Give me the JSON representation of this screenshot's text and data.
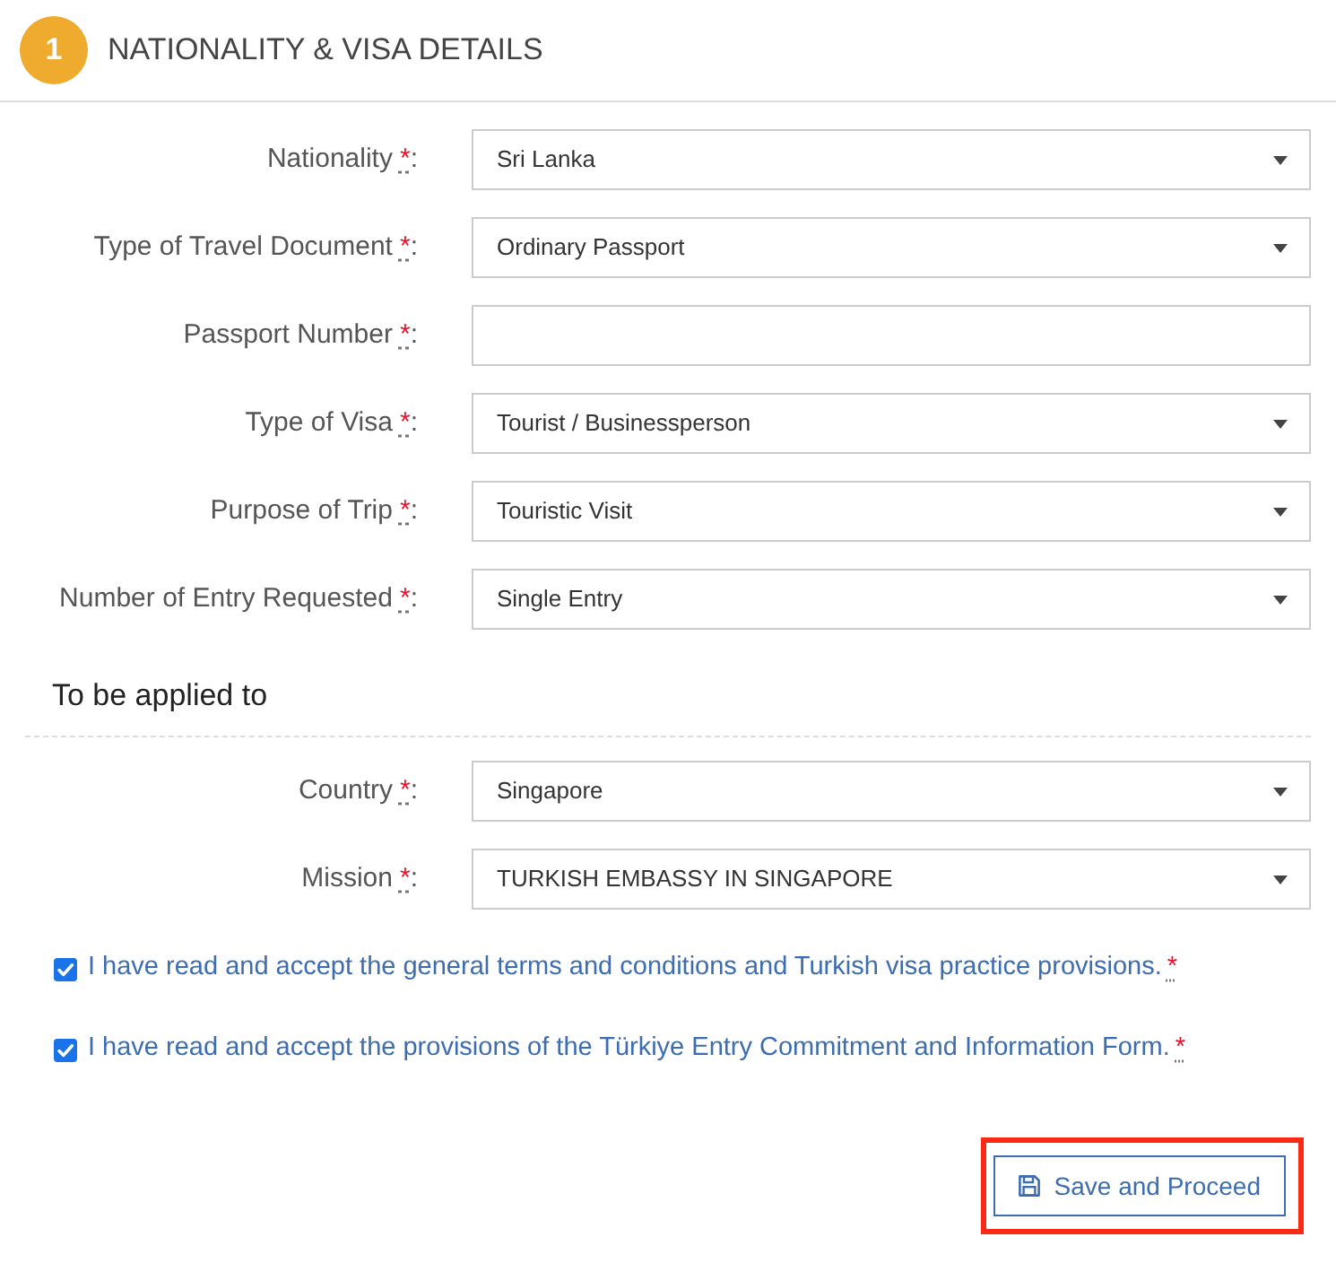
{
  "step": {
    "number": "1",
    "title": "NATIONALITY & VISA DETAILS"
  },
  "fields": [
    {
      "label": "Nationality",
      "required_mark": "*",
      "suffix": ":",
      "kind": "select",
      "value": "Sri Lanka"
    },
    {
      "label": "Type of Travel Document",
      "required_mark": "*",
      "suffix": ":",
      "kind": "select",
      "value": "Ordinary Passport"
    },
    {
      "label": "Passport Number",
      "required_mark": "*",
      "suffix": ":",
      "kind": "text"
    },
    {
      "label": "Type of Visa",
      "required_mark": "*",
      "suffix": ":",
      "kind": "select",
      "value": "Tourist / Businessperson"
    },
    {
      "label": "Purpose of Trip",
      "required_mark": "*",
      "suffix": ":",
      "kind": "select",
      "value": "Touristic Visit"
    },
    {
      "label": "Number of Entry Requested",
      "required_mark": "*",
      "suffix": ":",
      "kind": "select",
      "value": "Single Entry"
    }
  ],
  "applied_to": {
    "heading": "To be applied to",
    "fields": [
      {
        "label": "Country",
        "required_mark": "*",
        "suffix": ":",
        "kind": "select",
        "value": "Singapore"
      },
      {
        "label": "Mission",
        "required_mark": "*",
        "suffix": ":",
        "kind": "select",
        "value": "TURKISH EMBASSY IN SINGAPORE"
      }
    ]
  },
  "agreements": [
    {
      "text": "I have read and accept the general terms and conditions and Turkish visa practice provisions.",
      "required_mark": "*",
      "checked": true
    },
    {
      "text": "I have read and accept the provisions of the Türkiye Entry Commitment and Information Form.",
      "required_mark": "*",
      "checked": true
    }
  ],
  "save_button": {
    "label": "Save and Proceed",
    "highlighted": true
  }
}
